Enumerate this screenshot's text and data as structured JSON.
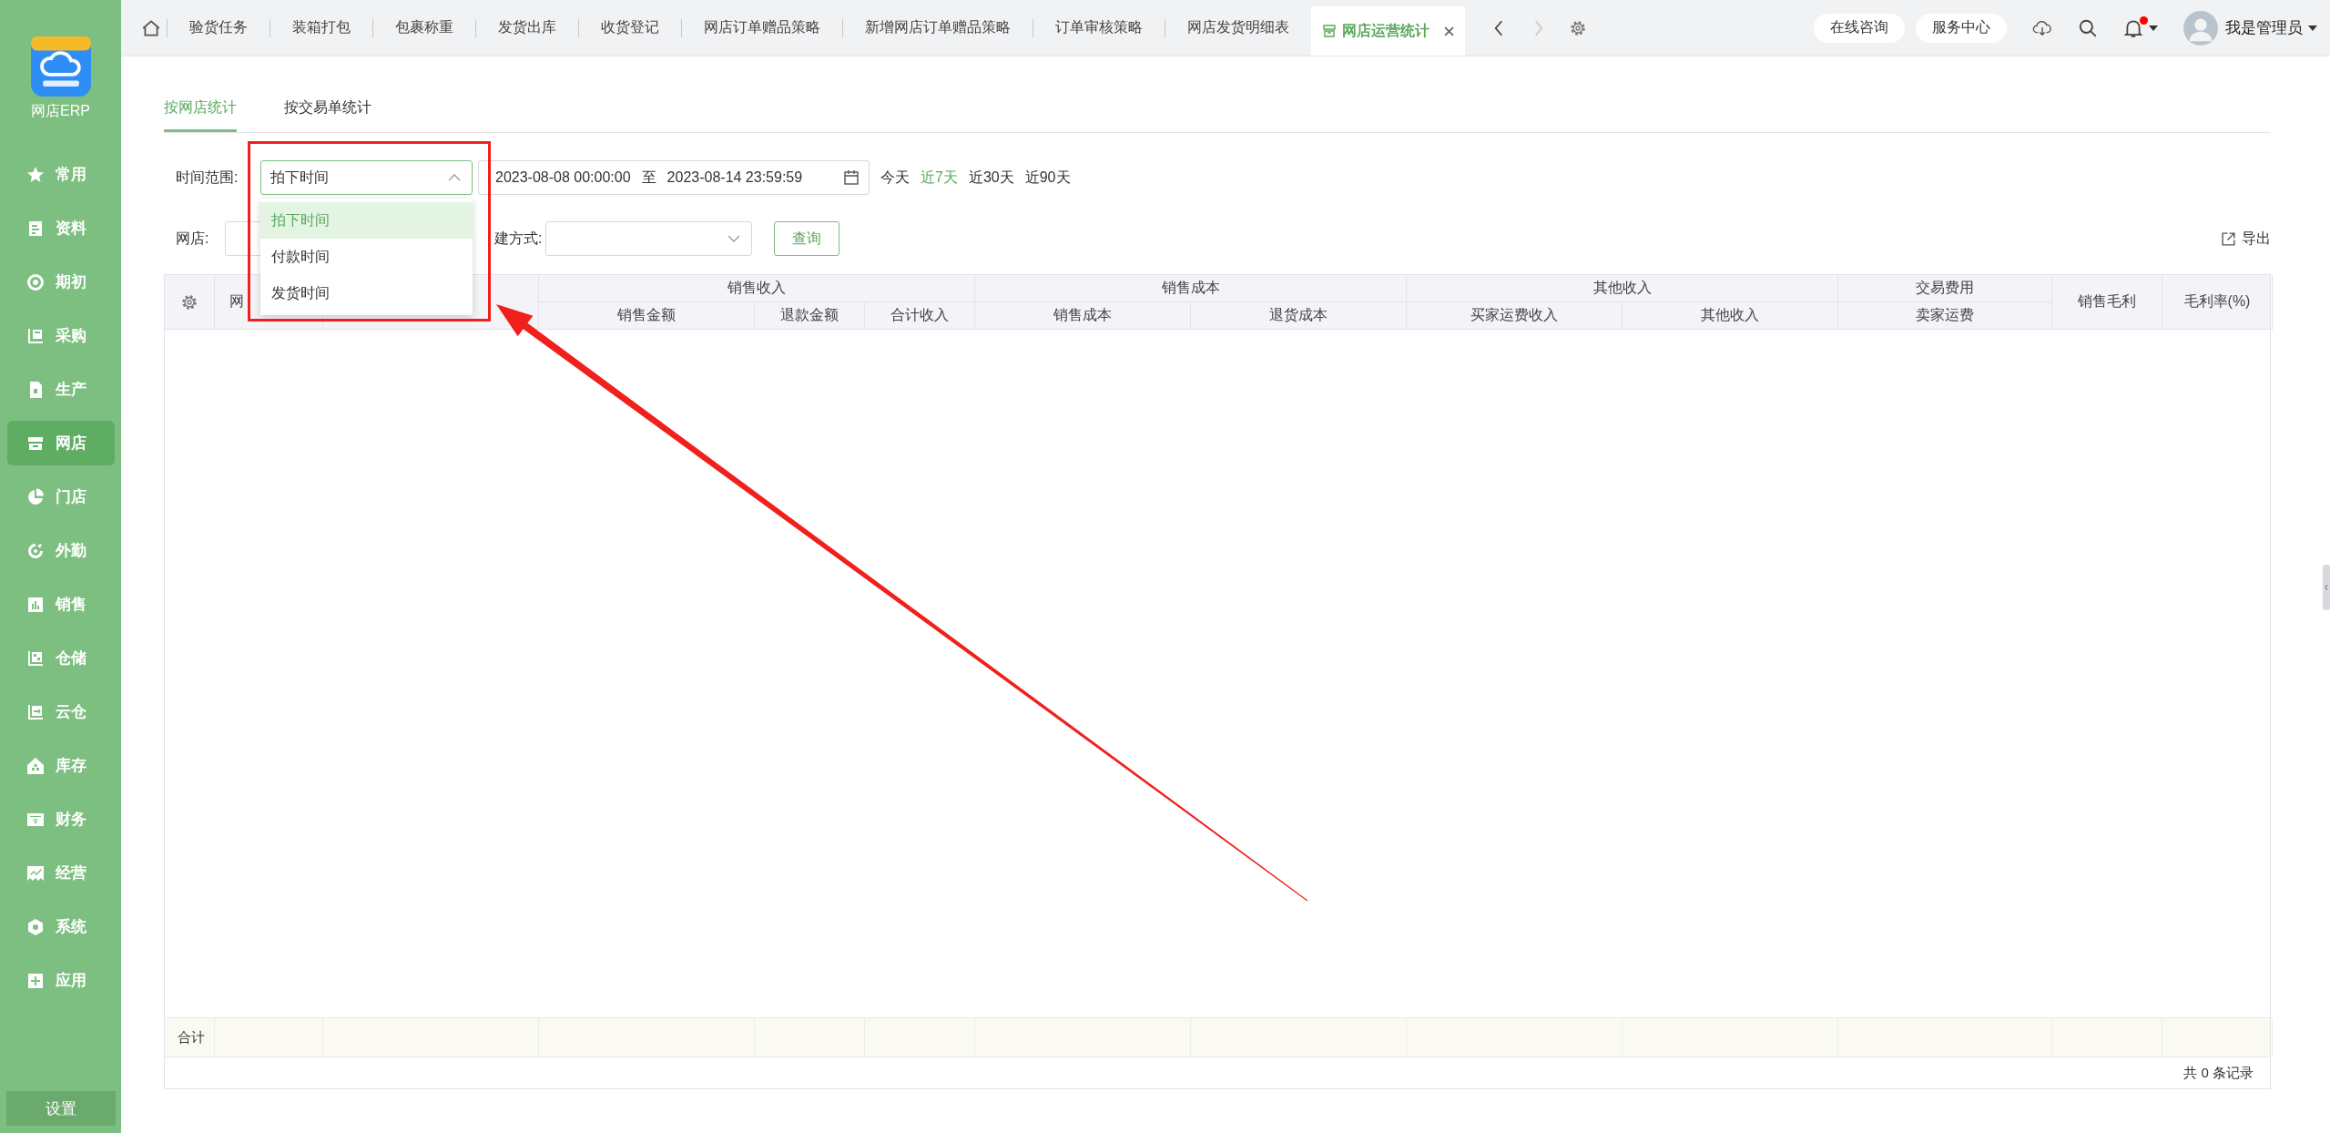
{
  "app": {
    "name": "网店ERP"
  },
  "sidebar": {
    "items": [
      {
        "label": "常用",
        "selected": false
      },
      {
        "label": "资料",
        "selected": false
      },
      {
        "label": "期初",
        "selected": false
      },
      {
        "label": "采购",
        "selected": false
      },
      {
        "label": "生产",
        "selected": false
      },
      {
        "label": "网店",
        "selected": true
      },
      {
        "label": "门店",
        "selected": false
      },
      {
        "label": "外勤",
        "selected": false
      },
      {
        "label": "销售",
        "selected": false
      },
      {
        "label": "仓储",
        "selected": false
      },
      {
        "label": "云仓",
        "selected": false
      },
      {
        "label": "库存",
        "selected": false
      },
      {
        "label": "财务",
        "selected": false
      },
      {
        "label": "经营",
        "selected": false
      },
      {
        "label": "系统",
        "selected": false
      },
      {
        "label": "应用",
        "selected": false
      }
    ],
    "footer": "设置"
  },
  "topbar": {
    "tabs": [
      {
        "label": "验货任务",
        "selected": false
      },
      {
        "label": "装箱打包",
        "selected": false
      },
      {
        "label": "包裹称重",
        "selected": false
      },
      {
        "label": "发货出库",
        "selected": false
      },
      {
        "label": "收货登记",
        "selected": false
      },
      {
        "label": "网店订单赠品策略",
        "selected": false
      },
      {
        "label": "新增网店订单赠品策略",
        "selected": false
      },
      {
        "label": "订单审核策略",
        "selected": false
      },
      {
        "label": "网店发货明细表",
        "selected": false
      },
      {
        "label": "网店运营统计",
        "selected": true
      }
    ],
    "forward_disabled": true,
    "actions": [
      "在线咨询",
      "服务中心"
    ],
    "notifications_unread": true,
    "user": "我是管理员"
  },
  "page_tabs": [
    {
      "label": "按网店统计",
      "selected": true
    },
    {
      "label": "按交易单统计",
      "selected": false
    }
  ],
  "filters": {
    "time_range": {
      "label": "时间范围:",
      "value": "拍下时间",
      "expanded": true,
      "options": [
        {
          "label": "拍下时间",
          "selected": true
        },
        {
          "label": "付款时间",
          "selected": false
        },
        {
          "label": "发货时间",
          "selected": false
        }
      ]
    },
    "date_start": "2023-08-08 00:00:00",
    "separator": "至",
    "date_end": "2023-08-14 23:59:59",
    "quick_ranges": [
      {
        "label": "今天",
        "selected": false
      },
      {
        "label": "近7天",
        "selected": true
      },
      {
        "label": "近30天",
        "selected": false
      },
      {
        "label": "近90天",
        "selected": false
      }
    ],
    "shop_label": "网店:",
    "create_method_label": "建方式:",
    "query_button": "查询",
    "export": "导出"
  },
  "table": {
    "columns": [
      {
        "kind": "single",
        "label": "网"
      },
      {
        "kind": "single"
      },
      {
        "kind": "group",
        "label": "销售收入",
        "columns": [
          "销售金额",
          "退款金额",
          "合计收入"
        ]
      },
      {
        "kind": "group",
        "label": "销售成本",
        "columns": [
          "销售成本",
          "退货成本"
        ]
      },
      {
        "kind": "group",
        "label": "其他收入",
        "columns": [
          "买家运费收入",
          "其他收入"
        ]
      },
      {
        "kind": "group",
        "label": "交易费用",
        "columns": [
          "卖家运费"
        ]
      },
      {
        "kind": "single",
        "label": "销售毛利"
      },
      {
        "kind": "single",
        "label": "毛利率(%)"
      }
    ],
    "total_label": "合计",
    "record_count": "共 0 条记录"
  }
}
